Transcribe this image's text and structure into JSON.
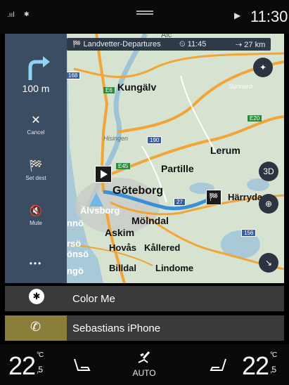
{
  "status": {
    "signal": ".ııl",
    "bluetooth": "✱",
    "play_icon": "play-icon",
    "time": "11:30"
  },
  "map": {
    "labels": [
      "Kungälv",
      "Hisingen",
      "Göteborg",
      "Lerum",
      "Partille",
      "Härryda",
      "Älvsborg",
      "Mölndal",
      "Askim",
      "Hovås",
      "Kållered",
      "Billdal",
      "Lindome",
      "nnö",
      "rsö",
      "önsö",
      "ngö",
      "Sunnerö",
      "Alc"
    ],
    "road_shields": [
      "168",
      "E6",
      "190",
      "E45",
      "27",
      "E20",
      "156"
    ],
    "compass": "compass-icon",
    "mode_3d": "3D"
  },
  "nav_panel": {
    "turn_icon": "turn-right-arrow-icon",
    "distance": "100 m",
    "cancel_label": "Cancel",
    "set_dest_label": "Set dest",
    "mute_label": "Mute",
    "more_label": "•••"
  },
  "route_bar": {
    "destination": "Landvetter-Departures",
    "eta": "11:45",
    "distance": "27 km"
  },
  "media": [
    {
      "source_icon": "bluetooth-icon",
      "label": "Color Me"
    },
    {
      "source_icon": "phone-icon",
      "label": "Sebastians iPhone"
    }
  ],
  "climate": {
    "left_temp": "22",
    "left_frac": ",5",
    "right_temp": "22",
    "right_frac": ",5",
    "unit": "°C",
    "mode": "AUTO",
    "fan_icon": "fan-icon",
    "left_seat_icon": "seat-heat-icon",
    "right_seat_icon": "seat-heat-icon"
  }
}
